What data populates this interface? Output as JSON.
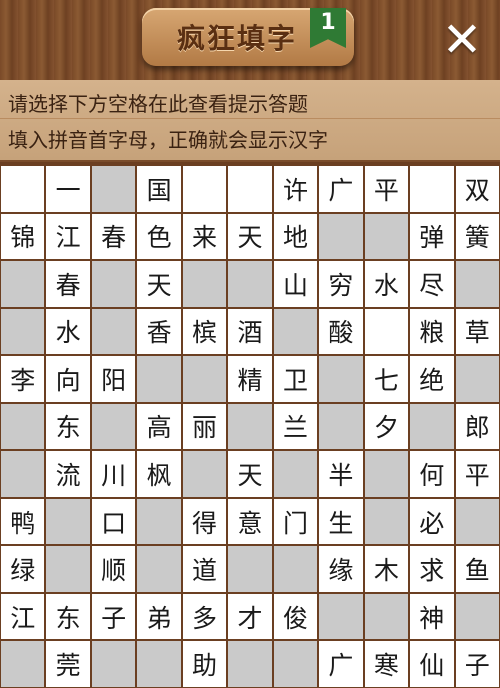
{
  "header": {
    "title": "疯狂填字",
    "level": "1",
    "close_symbol": "✕"
  },
  "hint": {
    "line1": "请选择下方空格在此查看提示答题",
    "line2": "填入拼音首字母，正确就会显示汉字"
  },
  "colors": {
    "wood": "#6b3f22",
    "white_cell": "#ffffff",
    "gray_cell": "#cacaca",
    "badge_green": "#2f7a34"
  },
  "grid": {
    "rows": [
      [
        "",
        "一",
        "#",
        "国",
        "",
        "",
        "许",
        "广",
        "平",
        "",
        "双"
      ],
      [
        "锦",
        "江",
        "春",
        "色",
        "来",
        "天",
        "地",
        "#",
        "#",
        "弹",
        "簧"
      ],
      [
        "#",
        "春",
        "#",
        "天",
        "#",
        "#",
        "山",
        "穷",
        "水",
        "尽",
        "#"
      ],
      [
        "#",
        "水",
        "#",
        "香",
        "槟",
        "酒",
        "#",
        "酸",
        "",
        "粮",
        "草"
      ],
      [
        "李",
        "向",
        "阳",
        "#",
        "#",
        "精",
        "卫",
        "#",
        "七",
        "绝",
        "#"
      ],
      [
        "#",
        "东",
        "#",
        "高",
        "丽",
        "#",
        "兰",
        "#",
        "夕",
        "#",
        "郎"
      ],
      [
        "#",
        "流",
        "川",
        "枫",
        "#",
        "天",
        "#",
        "半",
        "#",
        "何",
        "平"
      ],
      [
        "鸭",
        "#",
        "口",
        "#",
        "得",
        "意",
        "门",
        "生",
        "#",
        "必",
        "#"
      ],
      [
        "绿",
        "#",
        "顺",
        "#",
        "道",
        "#",
        "#",
        "缘",
        "木",
        "求",
        "鱼"
      ],
      [
        "江",
        "东",
        "子",
        "弟",
        "多",
        "才",
        "俊",
        "#",
        "#",
        "神",
        "#"
      ],
      [
        "#",
        "莞",
        "#",
        "#",
        "助",
        "#",
        "#",
        "广",
        "寒",
        "仙",
        "子"
      ]
    ]
  }
}
